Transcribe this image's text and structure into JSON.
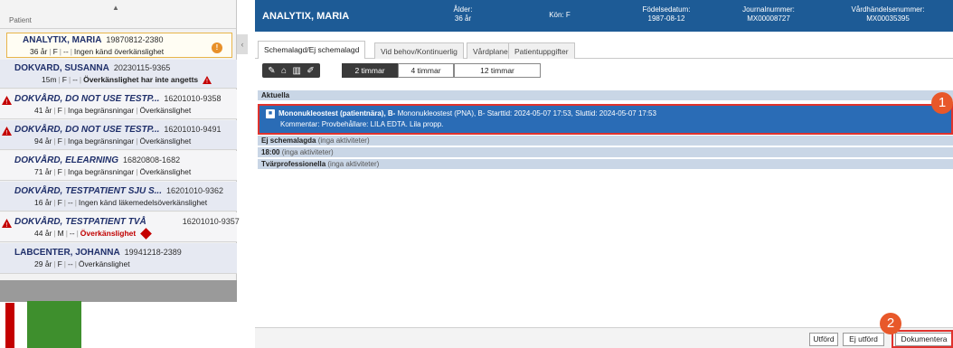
{
  "patient_list": {
    "header": "Patient",
    "patients": [
      {
        "name": "ANALYTIX, MARIA",
        "pnr": "19870812-2380",
        "age": "36 år",
        "sex": "F",
        "dash": "--",
        "info": "Ingen känd överkänslighet",
        "alert": "!"
      },
      {
        "name": "DOKVARD, SUSANNA",
        "pnr": "20230115-9365",
        "age": "15m",
        "sex": "F",
        "dash": "--",
        "info": "Överkänslighet har inte angetts"
      },
      {
        "name": "DOKVÅRD, DO NOT USE TESTP...",
        "pnr": "16201010-9358",
        "age": "41 år",
        "sex": "F",
        "info": "Inga begränsningar",
        "info2": "Överkänslighet"
      },
      {
        "name": "DOKVÅRD, DO NOT USE TESTP...",
        "pnr": "16201010-9491",
        "age": "94 år",
        "sex": "F",
        "info": "Inga begränsningar",
        "info2": "Överkänslighet"
      },
      {
        "name": "DOKVÅRD, ELEARNING",
        "pnr": "16820808-1682",
        "age": "71 år",
        "sex": "F",
        "info": "Inga begränsningar",
        "info2": "Överkänslighet"
      },
      {
        "name": "DOKVÅRD, TESTPATIENT SJU S...",
        "pnr": "16201010-9362",
        "age": "16 år",
        "sex": "F",
        "dash": "--",
        "info": "Ingen känd läkemedelsöverkänslighet"
      },
      {
        "name": "DOKVÅRD, TESTPATIENT TVÅ",
        "pnr": "16201010-9357",
        "age": "44 år",
        "sex": "M",
        "dash": "--",
        "info": "Överkänslighet"
      },
      {
        "name": "LABCENTER, JOHANNA",
        "pnr": "19941218-2389",
        "age": "29 år",
        "sex": "F",
        "dash": "--",
        "info": "Överkänslighet"
      }
    ]
  },
  "header": {
    "patient_name": "ANALYTIX, MARIA",
    "age_label": "Ålder:",
    "age_value": "36 år",
    "sex_label": "Kön: F",
    "dob_label": "Födelsedatum:",
    "dob_value": "1987-08-12",
    "journal_label": "Journalnummer:",
    "journal_value": "MX00008727",
    "event_label": "Vårdhändelsenummer:",
    "event_value": "MX00035395"
  },
  "tabs": [
    "Schemalagd/Ej schemalagd",
    "Vid behov/Kontinuerlig",
    "Vårdplaner",
    "Patientuppgifter"
  ],
  "toolbar": {
    "icons": [
      "syringe-icon",
      "lock-icon",
      "trash-icon",
      "edit-icon"
    ],
    "time_buttons": [
      "2 timmar",
      "4 timmar",
      "12 timmar"
    ]
  },
  "sections": {
    "aktuella": "Aktuella",
    "ej_schemalagda": "Ej schemalagda",
    "ej_schemalagda_note": "(inga aktiviteter)",
    "time_1800": "18:00",
    "time_1800_note": "(inga aktiviteter)",
    "tvarprof": "Tvärprofessionella",
    "tvarprof_note": "(inga aktiviteter)"
  },
  "activity": {
    "title": "Mononukleostest (patientnära), B-",
    "details": " Mononukleostest (PNA), B- Starttid: 2024-05-07 17:53, Sluttid: 2024-05-07 17:53",
    "comment": "Kommentar: Provbehållare: LILA EDTA. Lila propp."
  },
  "badges": {
    "one": "1",
    "two": "2"
  },
  "footer": {
    "utford": "Utförd",
    "ej_utford": "Ej utförd",
    "dokumentera": "Dokumentera"
  },
  "colors": {
    "header_blue": "#1d5b96",
    "activity_blue": "#2a6cb6",
    "section_blue": "#c9d6e6",
    "highlight_red": "#e0322d",
    "badge_orange": "#e8582a"
  }
}
